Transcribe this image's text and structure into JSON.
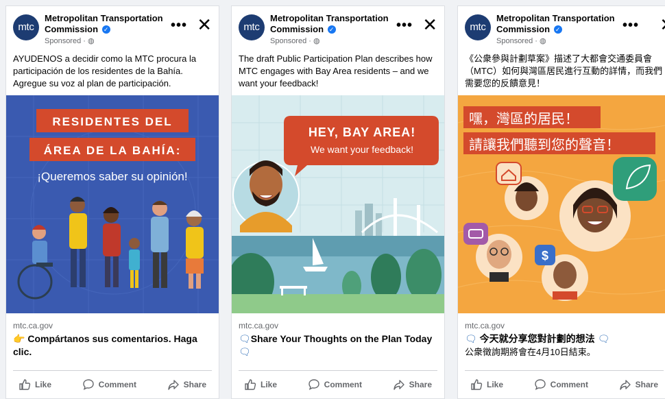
{
  "ads": [
    {
      "page_name": "Metropolitan Transportation Commission",
      "logo_text": "mtc",
      "sponsored": "Sponsored · ",
      "body": "AYUDENOS a decidir como la MTC procura la participación de los residentes de la Bahía. Agregue su voz al plan de participación.",
      "creative": {
        "line1": "RESIDENTES DEL",
        "line2": "ÁREA DE LA BAHÍA:",
        "line3": "¡Queremos saber su opinión!"
      },
      "domain": "mtc.ca.gov",
      "headline": "Compártanos sus comentarios. Haga clic.",
      "actions": {
        "like": "Like",
        "comment": "Comment",
        "share": "Share"
      }
    },
    {
      "page_name": "Metropolitan Transportation Commission",
      "logo_text": "mtc",
      "sponsored": "Sponsored · ",
      "body": "The draft Public Participation Plan describes how MTC engages with Bay Area residents – and we want your feedback!",
      "creative": {
        "line1": "HEY, BAY AREA!",
        "line2": "We want your feedback!"
      },
      "domain": "mtc.ca.gov",
      "headline": "Share Your Thoughts on the Plan Today",
      "actions": {
        "like": "Like",
        "comment": "Comment",
        "share": "Share"
      }
    },
    {
      "page_name": "Metropolitan Transportation Commission",
      "logo_text": "mtc",
      "sponsored": "Sponsored · ",
      "body": "《公衆參與計劃草案》描述了大都會交通委員會（MTC）如何與灣區居民進行互動的詳情，而我們需要您的反饋意見！",
      "creative": {
        "line1": "嘿，灣區的居民！",
        "line2": "請讓我們聽到您的聲音！"
      },
      "domain": "mtc.ca.gov",
      "headline": "今天就分享您對計劃的想法",
      "headline_sub": "公衆徵詢期將會在4月10日結束。",
      "actions": {
        "like": "Like",
        "comment": "Comment",
        "share": "Share"
      }
    }
  ],
  "colors": {
    "brand_navy": "#1d3c72",
    "facebook_blue": "#1877f2",
    "banner_red": "#d44a2c",
    "creative_blue": "#3a5ab0",
    "creative_orange": "#f4a640",
    "sky_teal": "#d8ecef"
  },
  "icons": [
    "verified-icon",
    "more-icon",
    "close-icon",
    "globe-icon",
    "like-icon",
    "comment-icon",
    "share-icon",
    "speech-bubble-icon",
    "pointing-hand-icon"
  ]
}
